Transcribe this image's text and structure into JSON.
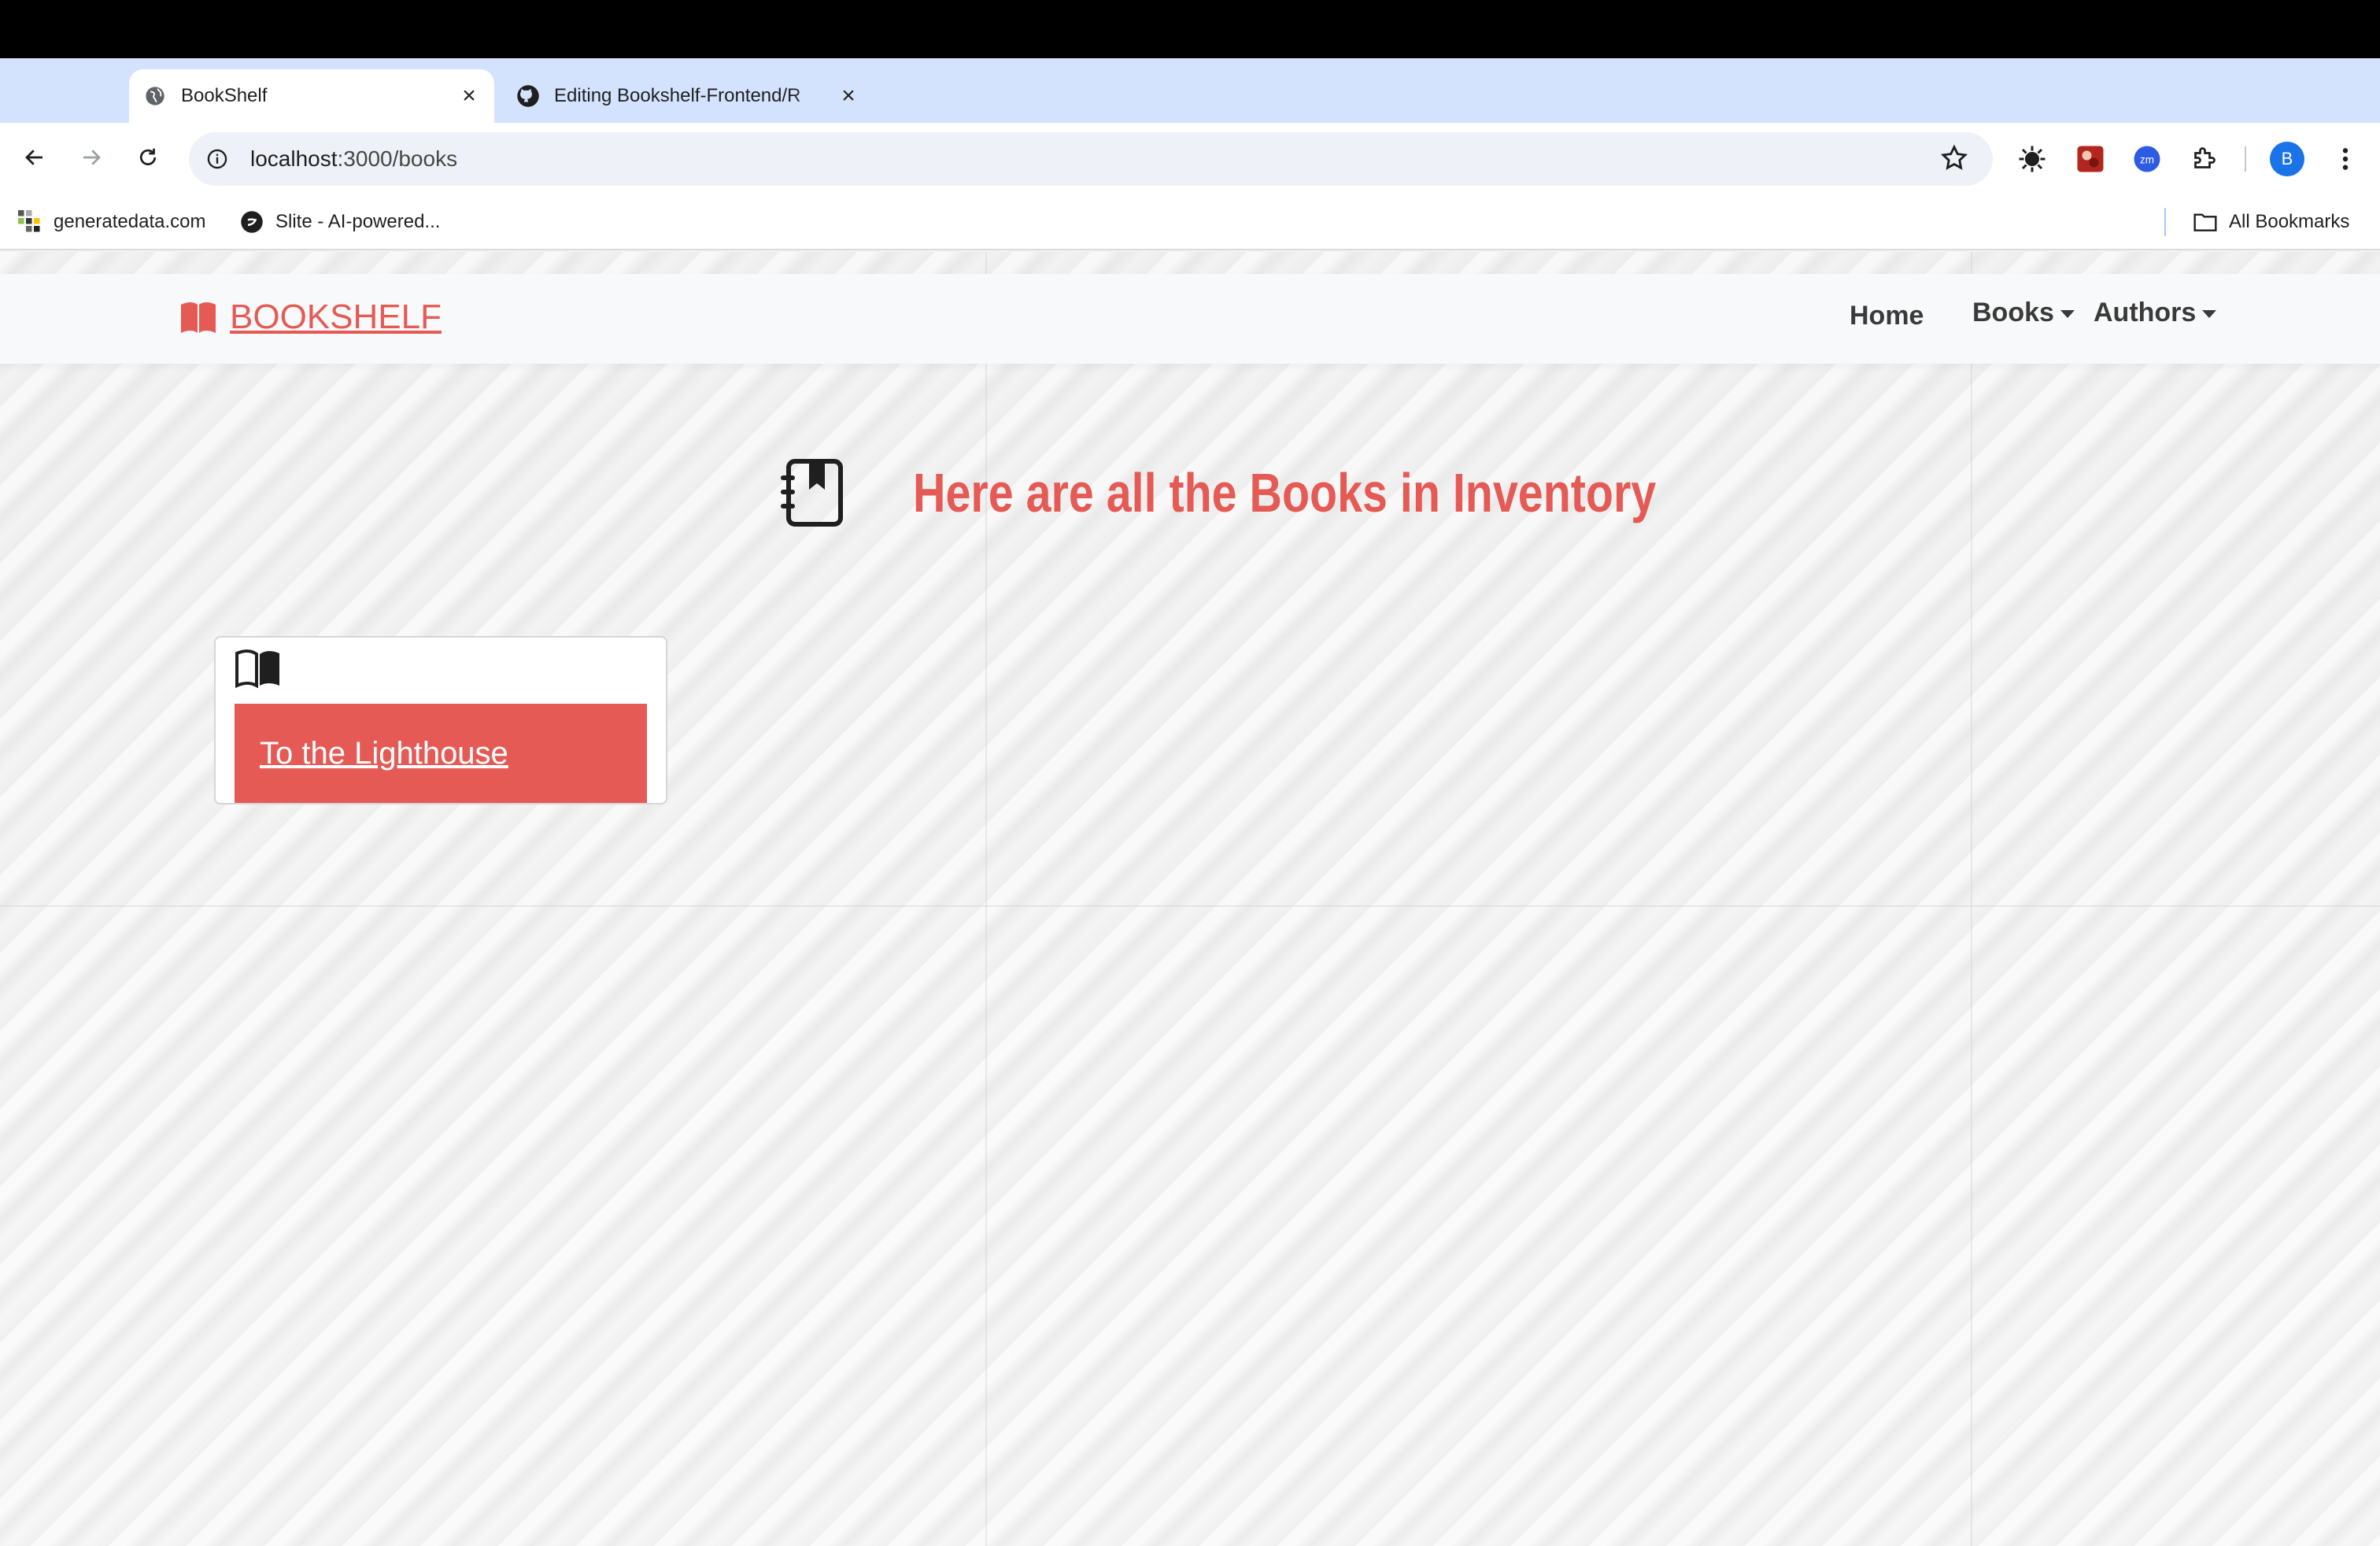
{
  "browser": {
    "tabs": [
      {
        "title": "BookShelf",
        "active": true
      },
      {
        "title": "Editing Bookshelf-Frontend/R",
        "active": false
      }
    ],
    "address": {
      "host": "localhost",
      "path": ":3000/books"
    },
    "bookmarks": [
      {
        "label": "generatedata.com"
      },
      {
        "label": "Slite - AI-powered..."
      }
    ],
    "all_bookmarks_label": "All Bookmarks",
    "profile_initial": "B"
  },
  "site": {
    "brand": "BOOKSHELF",
    "nav": {
      "home": "Home",
      "books": "Books",
      "authors": "Authors"
    },
    "heading": "Here are all the Books in Inventory",
    "books": [
      {
        "title": "To the Lighthouse"
      }
    ]
  },
  "colors": {
    "accent": "#e55a55",
    "tab_strip": "#d3e3fd",
    "navbar_bg": "#f8f9fa"
  }
}
